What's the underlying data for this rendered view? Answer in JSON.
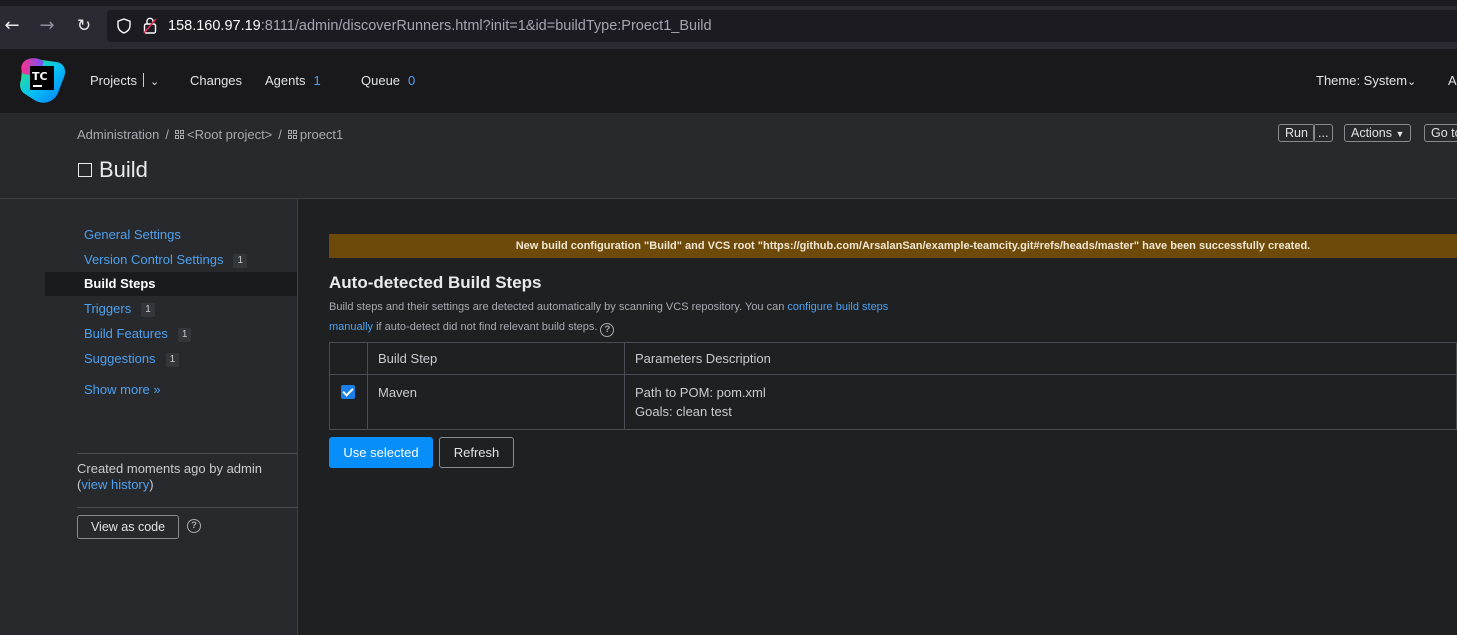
{
  "browser": {
    "url_host": "158.160.97.19",
    "url_rest": ":8111/admin/discoverRunners.html?init=1&id=buildType:Proect1_Build"
  },
  "header": {
    "logo_text": "TC",
    "projects_label": "Projects",
    "changes_label": "Changes",
    "agents_label": "Agents",
    "agents_count": "1",
    "queue_label": "Queue",
    "queue_count": "0",
    "theme_label": "Theme: System",
    "user_initial": "A"
  },
  "breadcrumb": {
    "items": [
      "Administration",
      "<Root project>",
      "proect1"
    ]
  },
  "page": {
    "title": "Build",
    "run_label": "Run",
    "run_more_label": "...",
    "actions_label": "Actions",
    "goto_label": "Go to"
  },
  "sidebar": {
    "items": [
      {
        "label": "General Settings",
        "badge": ""
      },
      {
        "label": "Version Control Settings",
        "badge": "1"
      },
      {
        "label": "Build Steps",
        "badge": ""
      },
      {
        "label": "Triggers",
        "badge": "1"
      },
      {
        "label": "Build Features",
        "badge": "1"
      },
      {
        "label": "Suggestions",
        "badge": "1"
      }
    ],
    "show_more": "Show more »",
    "created_text": "Created moments ago by admin",
    "view_history": "view history",
    "view_as_code": "View as code"
  },
  "main": {
    "banner": "New build configuration \"Build\" and VCS root \"https://github.com/ArsalanSan/example-teamcity.git#refs/heads/master\" have been successfully created.",
    "section_title": "Auto-detected Build Steps",
    "desc_part1": "Build steps and their settings are detected automatically by scanning VCS repository. You can ",
    "desc_link1": "configure build steps",
    "desc_link2": "manually",
    "desc_part2": " if auto-detect did not find relevant build steps.",
    "table": {
      "headers": [
        "Build Step",
        "Parameters Description"
      ],
      "rows": [
        {
          "checked": true,
          "step": "Maven",
          "param_line1": "Path to POM: pom.xml",
          "param_line2": "Goals: clean test"
        }
      ]
    },
    "use_selected_label": "Use selected",
    "refresh_label": "Refresh"
  },
  "colors": {
    "accent": "#088ef9",
    "link": "#4ea1f0",
    "banner_bg": "#6e4a0a"
  }
}
